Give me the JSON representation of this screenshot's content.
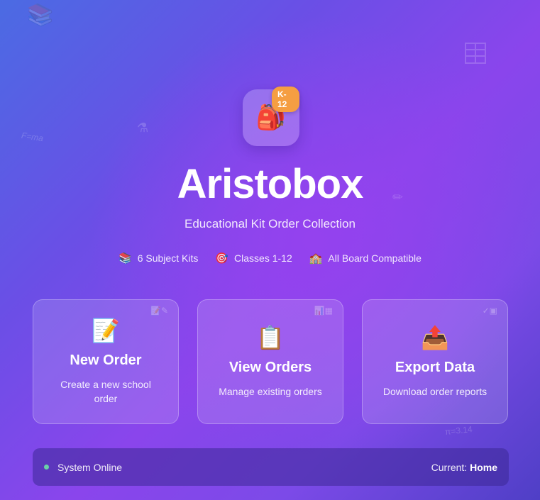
{
  "logo": {
    "icon": "backpack-icon",
    "glyph": "🎒",
    "badge": "K-12"
  },
  "app": {
    "title": "Aristobox",
    "subtitle": "Educational Kit Order Collection"
  },
  "features": [
    {
      "icon": "books-icon",
      "glyph": "📚",
      "label": "6 Subject Kits"
    },
    {
      "icon": "target-icon",
      "glyph": "🎯",
      "label": "Classes 1-12"
    },
    {
      "icon": "school-icon",
      "glyph": "🏫",
      "label": "All Board Compatible"
    }
  ],
  "cards": [
    {
      "icon": "memo-icon",
      "glyph": "📝",
      "title": "New Order",
      "desc": "Create a new school order"
    },
    {
      "icon": "clipboard-icon",
      "glyph": "📋",
      "title": "View Orders",
      "desc": "Manage existing orders"
    },
    {
      "icon": "outbox-icon",
      "glyph": "📤",
      "title": "Export Data",
      "desc": "Download order reports"
    }
  ],
  "status": {
    "text": "System Online",
    "current_label": "Current:",
    "current_value": "Home",
    "dot_color": "#6ad0a8"
  },
  "colors": {
    "badge": "#f59e42",
    "bg_start": "#4b6be3",
    "bg_mid": "#8a45ec"
  }
}
